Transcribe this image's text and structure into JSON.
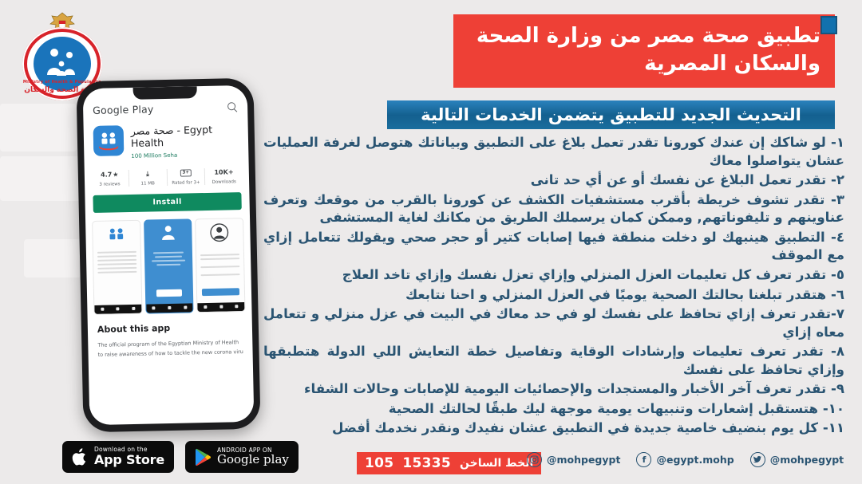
{
  "colors": {
    "background": "#eceaea",
    "red": "#ee4036",
    "blue": "#14608f",
    "text_blue": "#2a5472",
    "install_green": "#0f8a5f"
  },
  "logo": {
    "english": "Ministry of Health & Population",
    "arabic": "وزارة الصحة والسكان"
  },
  "header": {
    "title_line1": "تطبيق صحة مصر من وزارة الصحة",
    "title_line2": "والسكان المصرية",
    "subtitle": "التحديث الجديد للتطبيق يتضمن الخدمات التالية"
  },
  "services": [
    "١- لو شاكك إن عندك كورونا تقدر تعمل بلاغ على التطبيق وبياناتك هتوصل لغرفة العمليات عشان يتواصلوا معاك",
    "٢- تقدر تعمل البلاغ عن نفسك أو عن أي حد تانى",
    "٣- تقدر تشوف خريطة بأقرب مستشفيات الكشف عن كورونا بالقرب من موقعك وتعرف عناوينهم و تليفوناتهم, وممكن كمان يرسملك الطريق من مكانك لغاية المستشفى",
    "٤- التطبيق هينبهك لو دخلت منطقة فيها إصابات كتير أو حجر صحي ويقولك تتعامل إزاي مع الموقف",
    "٥- تقدر تعرف كل تعليمات العزل المنزلي وإزاي تعزل نفسك وإزاي تاخد العلاج",
    "٦- هتقدر تبلغنا بحالتك الصحية يوميًا في العزل المنزلي و احنا نتابعك",
    "٧-تقدر تعرف إزاي تحافظ على نفسك لو في حد معاك في البيت في عزل منزلي و تتعامل معاه إزاي",
    "٨- تقدر تعرف تعليمات وإرشادات الوقاية وتفاصيل خطة التعايش اللي الدولة هتطبقها وإزاي تحافظ على نفسك",
    "٩- تقدر تعرف آخر الأخبار والمستجدات والإحصائيات اليومية للإصابات وحالات الشفاء",
    "١٠- هتستقبل إشعارات وتنبيهات يومية موجهة ليك طبقًا لحالتك الصحية",
    "١١- كل يوم بنضيف خاصية جديدة في التطبيق عشان نفيدك ونقدر نخدمك أفضل"
  ],
  "phone": {
    "store_name": "Google Play",
    "app_name": "صحة مصر - Egypt Health",
    "developer": "100 Million Seha",
    "stats": [
      {
        "top": "4.7",
        "star": "★",
        "bottom": "3 reviews"
      },
      {
        "top": "11 MB",
        "star": "",
        "bottom": ""
      },
      {
        "top": "3+",
        "star": "",
        "bottom": "Rated for 3+"
      },
      {
        "top": "10K+",
        "star": "",
        "bottom": "Downloads"
      }
    ],
    "install_label": "Install",
    "about_title": "About this app",
    "about_line1": "The official program of the Egyptian Ministry of Health",
    "about_line2": "to raise awareness of how to tackle the new corona virus"
  },
  "store_badges": {
    "apple_small": "Download on the",
    "apple_big": "App Store",
    "google_small": "ANDROID APP ON",
    "google_big": "Google play"
  },
  "footer": {
    "hotline_label": "الخط الساخن",
    "hotline_number_1": "15335",
    "hotline_number_2": "105",
    "socials": [
      {
        "icon": "instagram-icon",
        "glyph": "◉",
        "handle": "@mohpegypt"
      },
      {
        "icon": "facebook-icon",
        "glyph": "f",
        "handle": "@egypt.mohp"
      },
      {
        "icon": "twitter-icon",
        "glyph": "🐦",
        "handle": "@mohpegypt"
      }
    ]
  }
}
